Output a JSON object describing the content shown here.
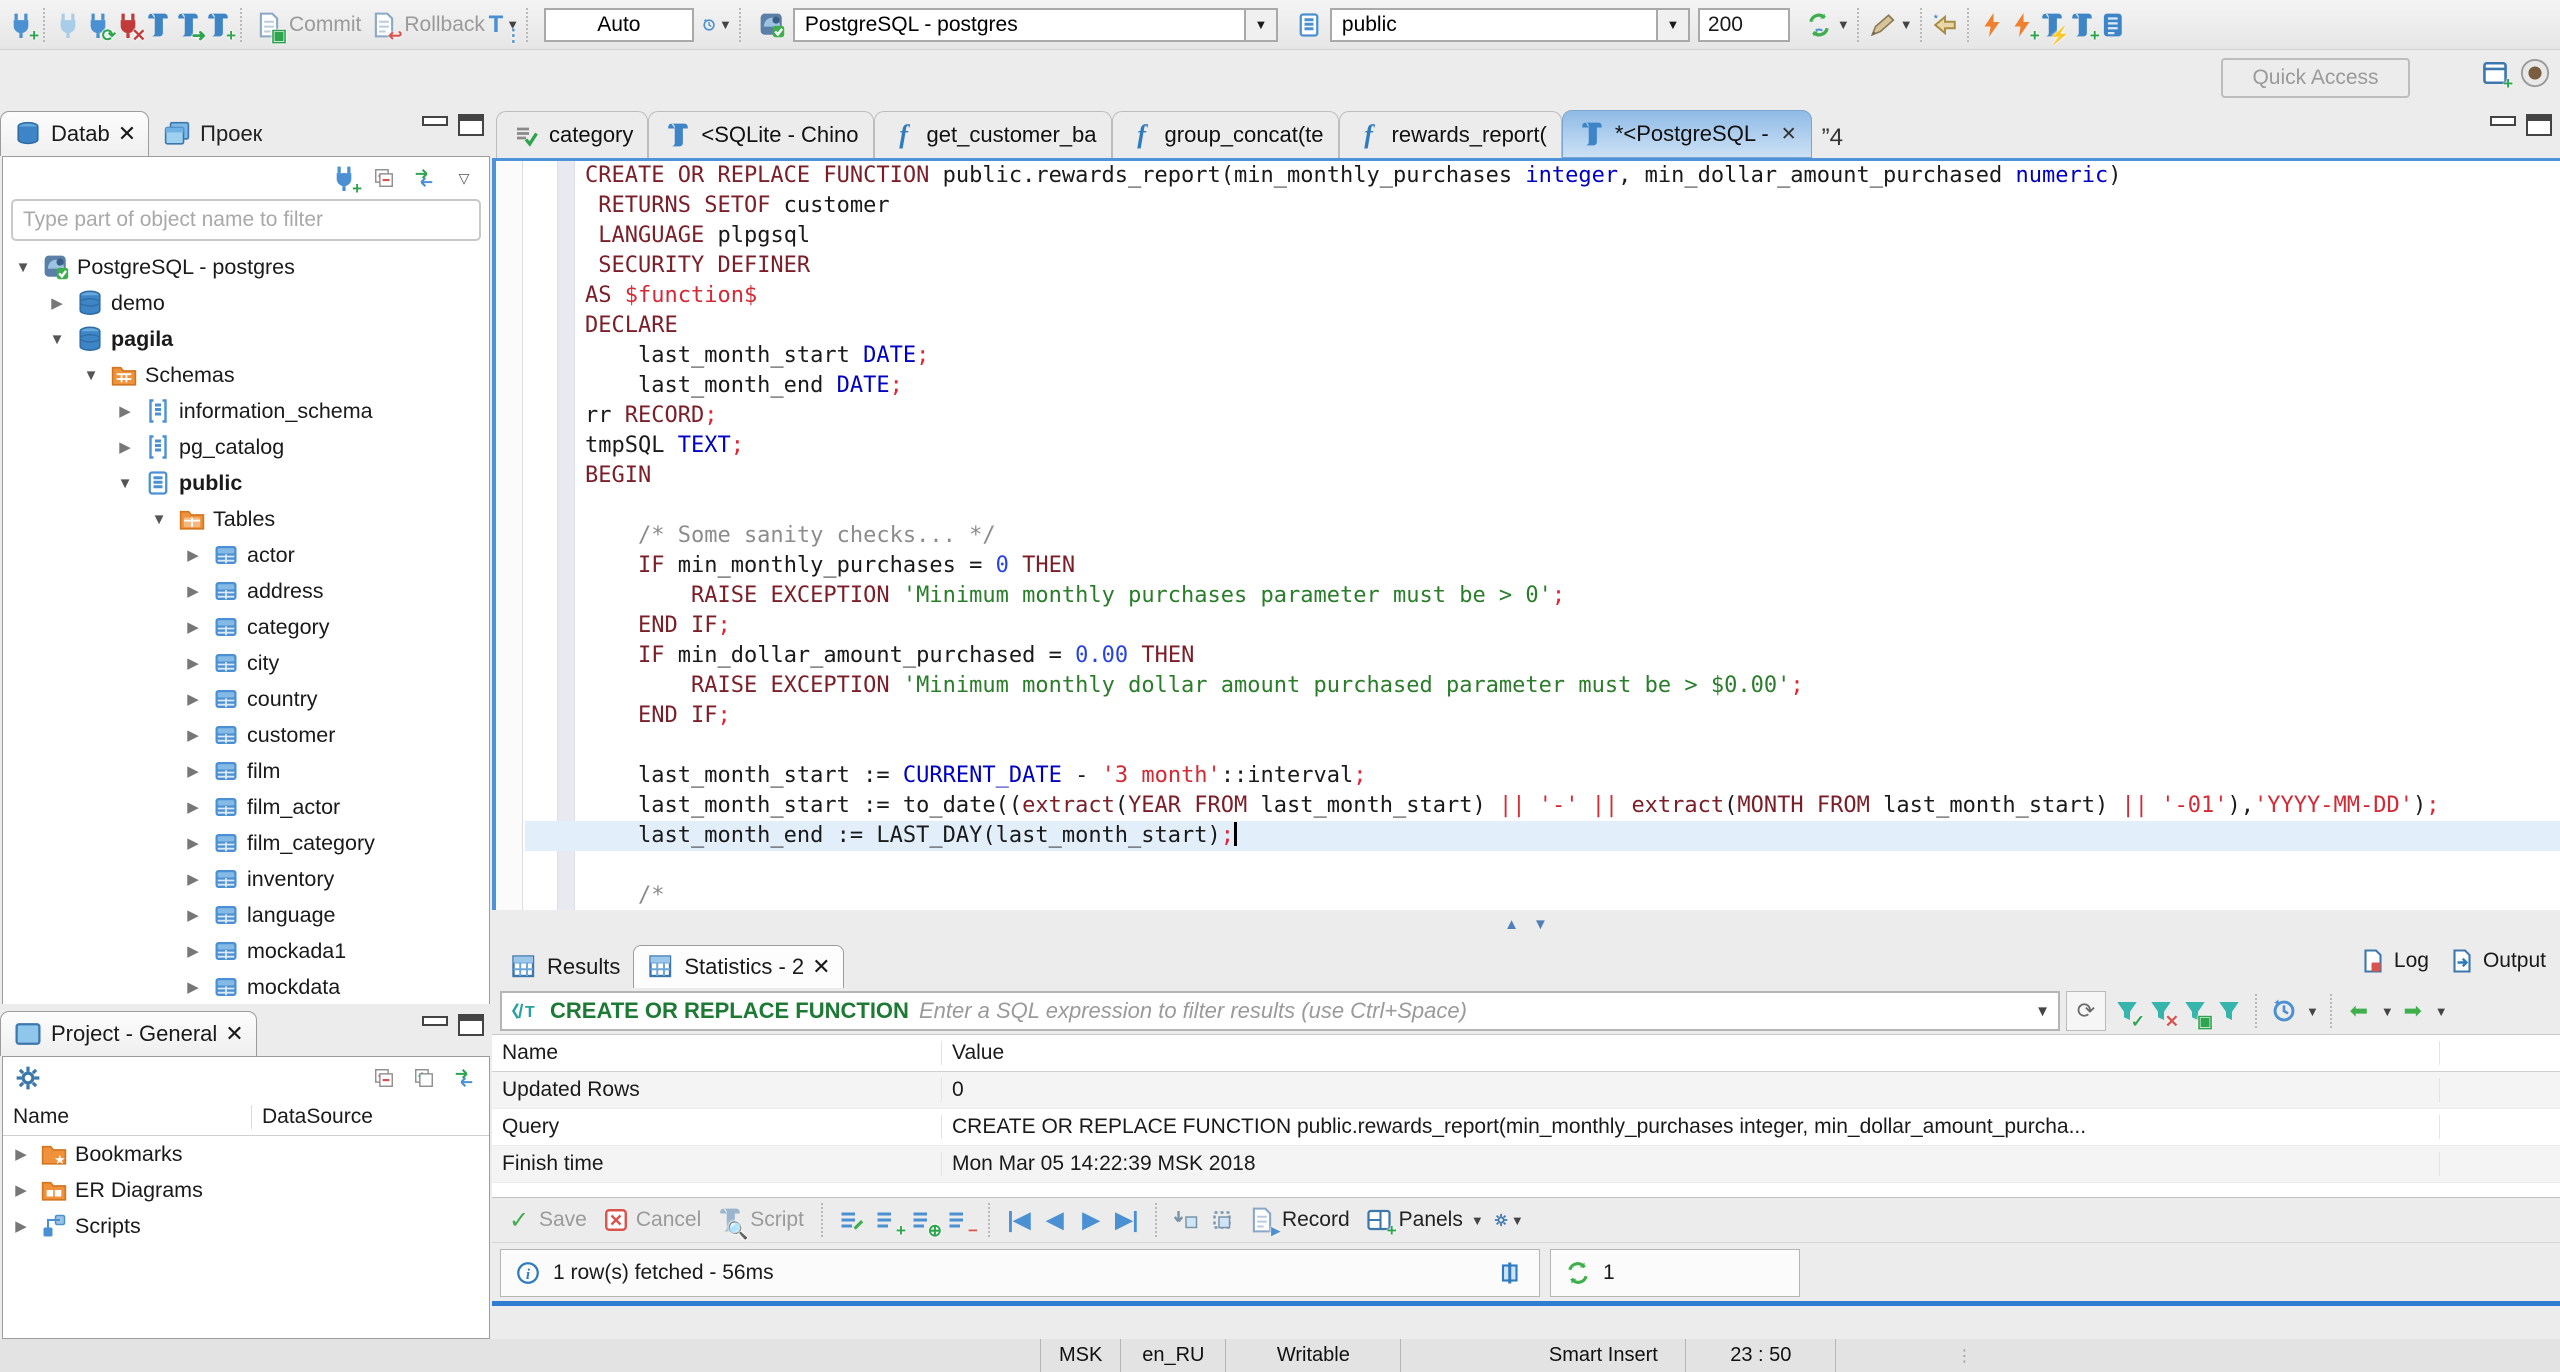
{
  "toolbar": {
    "main_icons_left": [
      "new-connection",
      "connect",
      "reconnect",
      "disconnect",
      "sql-editor",
      "open-sql-script",
      "new-sql-editor"
    ],
    "commit_label": "Commit",
    "rollback_label": "Rollback",
    "transaction_mode_icon": "transaction-mode",
    "auto_label": "Auto",
    "history_icon": "clock-history",
    "connection_combo": {
      "icon": "postgres-connection",
      "value": "PostgreSQL - postgres"
    },
    "schema_combo": {
      "icon": "schema-page",
      "value": "public"
    },
    "fetch_size": "200",
    "main_icons_right": [
      "sync-connection",
      "assistant-pen",
      "back-star",
      "execute-bolt",
      "execute-bolt-new",
      "script-bolt",
      "script-new",
      "script-list"
    ],
    "quick_access_placeholder": "Quick Access",
    "corner_icons": [
      "open-perspective",
      "dbeaver-perspective"
    ]
  },
  "navigator": {
    "tab_database": "Datab",
    "tab_project": "Проек",
    "toolbar_icons": [
      "connect-plug",
      "collapse-all",
      "link-editor",
      "view-menu"
    ],
    "filter_placeholder": "Type part of object name to filter",
    "items": [
      {
        "label": "PostgreSQL - postgres",
        "level": 0,
        "state": "open",
        "icon": "conn",
        "bold": false
      },
      {
        "label": "demo",
        "level": 1,
        "state": "closed",
        "icon": "db",
        "bold": false
      },
      {
        "label": "pagila",
        "level": 1,
        "state": "open",
        "icon": "db",
        "bold": true
      },
      {
        "label": "Schemas",
        "level": 2,
        "state": "open",
        "icon": "folder-schemas",
        "bold": false
      },
      {
        "label": "information_schema",
        "level": 3,
        "state": "closed",
        "icon": "schema",
        "bold": false
      },
      {
        "label": "pg_catalog",
        "level": 3,
        "state": "closed",
        "icon": "schema",
        "bold": false
      },
      {
        "label": "public",
        "level": 3,
        "state": "open",
        "icon": "schema-bold",
        "bold": true
      },
      {
        "label": "Tables",
        "level": 4,
        "state": "open",
        "icon": "folder-tables",
        "bold": false
      },
      {
        "label": "actor",
        "level": 5,
        "state": "closed",
        "icon": "table",
        "bold": false
      },
      {
        "label": "address",
        "level": 5,
        "state": "closed",
        "icon": "table",
        "bold": false
      },
      {
        "label": "category",
        "level": 5,
        "state": "closed",
        "icon": "table",
        "bold": false
      },
      {
        "label": "city",
        "level": 5,
        "state": "closed",
        "icon": "table",
        "bold": false
      },
      {
        "label": "country",
        "level": 5,
        "state": "closed",
        "icon": "table",
        "bold": false
      },
      {
        "label": "customer",
        "level": 5,
        "state": "closed",
        "icon": "table",
        "bold": false
      },
      {
        "label": "film",
        "level": 5,
        "state": "closed",
        "icon": "table",
        "bold": false
      },
      {
        "label": "film_actor",
        "level": 5,
        "state": "closed",
        "icon": "table",
        "bold": false
      },
      {
        "label": "film_category",
        "level": 5,
        "state": "closed",
        "icon": "table",
        "bold": false
      },
      {
        "label": "inventory",
        "level": 5,
        "state": "closed",
        "icon": "table",
        "bold": false
      },
      {
        "label": "language",
        "level": 5,
        "state": "closed",
        "icon": "table",
        "bold": false
      },
      {
        "label": "mockada1",
        "level": 5,
        "state": "closed",
        "icon": "table",
        "bold": false
      },
      {
        "label": "mockdata",
        "level": 5,
        "state": "closed",
        "icon": "table",
        "bold": false
      }
    ]
  },
  "project_panel": {
    "title": "Project - General",
    "toolbar_icons": [
      "gear",
      "collapse-all",
      "expand-all",
      "link-editor"
    ],
    "columns": [
      "Name",
      "DataSource"
    ],
    "items": [
      {
        "label": "Bookmarks",
        "icon": "bookmarks"
      },
      {
        "label": "ER Diagrams",
        "icon": "erd"
      },
      {
        "label": "Scripts",
        "icon": "scripts"
      }
    ]
  },
  "editor": {
    "tabs": [
      {
        "label": "category",
        "icon": "checklist",
        "active": false
      },
      {
        "label": "<SQLite - Chino",
        "icon": "sql",
        "active": false
      },
      {
        "label": "get_customer_ba",
        "icon": "function",
        "active": false
      },
      {
        "label": "group_concat(te",
        "icon": "function",
        "active": false
      },
      {
        "label": "rewards_report(",
        "icon": "function",
        "active": false
      },
      {
        "label": "*<PostgreSQL - ",
        "icon": "sql",
        "active": true,
        "closable": true
      }
    ],
    "overflow_count": "”4",
    "current_line": 23,
    "code_lines": [
      [
        [
          "kw",
          "CREATE OR REPLACE FUNCTION"
        ],
        [
          "id",
          " public.rewards_report(min_monthly_purchases "
        ],
        [
          "ty",
          "integer"
        ],
        [
          "id",
          ", min_dollar_amount_purchased "
        ],
        [
          "ty",
          "numeric"
        ],
        [
          "id",
          ")"
        ]
      ],
      [
        [
          "id",
          " "
        ],
        [
          "kw",
          "RETURNS SETOF"
        ],
        [
          "id",
          " customer"
        ]
      ],
      [
        [
          "id",
          " "
        ],
        [
          "kw",
          "LANGUAGE"
        ],
        [
          "id",
          " plpgsql"
        ]
      ],
      [
        [
          "id",
          " "
        ],
        [
          "kw",
          "SECURITY DEFINER"
        ]
      ],
      [
        [
          "kw",
          "AS"
        ],
        [
          "rs",
          " $function$"
        ]
      ],
      [
        [
          "kw",
          "DECLARE"
        ]
      ],
      [
        [
          "id",
          "    last_month_start "
        ],
        [
          "ty",
          "DATE"
        ],
        [
          "pn",
          ";"
        ]
      ],
      [
        [
          "id",
          "    last_month_end "
        ],
        [
          "ty",
          "DATE"
        ],
        [
          "pn",
          ";"
        ]
      ],
      [
        [
          "id",
          "rr "
        ],
        [
          "kw",
          "RECORD"
        ],
        [
          "pn",
          ";"
        ]
      ],
      [
        [
          "id",
          "tmpSQL "
        ],
        [
          "ty",
          "TEXT"
        ],
        [
          "pn",
          ";"
        ]
      ],
      [
        [
          "kw",
          "BEGIN"
        ]
      ],
      [],
      [
        [
          "cm",
          "    /* Some sanity checks... */"
        ]
      ],
      [
        [
          "id",
          "    "
        ],
        [
          "kw",
          "IF"
        ],
        [
          "id",
          " min_monthly_purchases = "
        ],
        [
          "num",
          "0"
        ],
        [
          "id",
          " "
        ],
        [
          "kw",
          "THEN"
        ]
      ],
      [
        [
          "id",
          "        "
        ],
        [
          "kw",
          "RAISE EXCEPTION"
        ],
        [
          "str",
          " 'Minimum monthly purchases parameter must be > 0'"
        ],
        [
          "pn",
          ";"
        ]
      ],
      [
        [
          "id",
          "    "
        ],
        [
          "kw",
          "END IF"
        ],
        [
          "pn",
          ";"
        ]
      ],
      [
        [
          "id",
          "    "
        ],
        [
          "kw",
          "IF"
        ],
        [
          "id",
          " min_dollar_amount_purchased = "
        ],
        [
          "num",
          "0.00"
        ],
        [
          "id",
          " "
        ],
        [
          "kw",
          "THEN"
        ]
      ],
      [
        [
          "id",
          "        "
        ],
        [
          "kw",
          "RAISE EXCEPTION"
        ],
        [
          "str",
          " 'Minimum monthly dollar amount purchased parameter must be > $0.00'"
        ],
        [
          "pn",
          ";"
        ]
      ],
      [
        [
          "id",
          "    "
        ],
        [
          "kw",
          "END IF"
        ],
        [
          "pn",
          ";"
        ]
      ],
      [],
      [
        [
          "id",
          "    last_month_start := "
        ],
        [
          "ty",
          "CURRENT_DATE"
        ],
        [
          "id",
          " - "
        ],
        [
          "rs",
          "'3 month'"
        ],
        [
          "id",
          "::interval"
        ],
        [
          "pn",
          ";"
        ]
      ],
      [
        [
          "id",
          "    last_month_start := to_date(("
        ],
        [
          "kw",
          "extract"
        ],
        [
          "id",
          "("
        ],
        [
          "kw",
          "YEAR"
        ],
        [
          "id",
          " "
        ],
        [
          "kw",
          "FROM"
        ],
        [
          "id",
          " last_month_start) "
        ],
        [
          "op",
          "||"
        ],
        [
          "rs",
          " '-' "
        ],
        [
          "op",
          "||"
        ],
        [
          "id",
          " "
        ],
        [
          "kw",
          "extract"
        ],
        [
          "id",
          "("
        ],
        [
          "kw",
          "MONTH"
        ],
        [
          "id",
          " "
        ],
        [
          "kw",
          "FROM"
        ],
        [
          "id",
          " last_month_start) "
        ],
        [
          "op",
          "||"
        ],
        [
          "rs",
          " '-01'"
        ],
        [
          "id",
          "),"
        ],
        [
          "rs",
          "'YYYY-MM-DD'"
        ],
        [
          "id",
          ")"
        ],
        [
          "pn",
          ";"
        ]
      ],
      [
        [
          "id",
          "    last_month_end := LAST_DAY(last_month_start)"
        ],
        [
          "pn",
          ";"
        ]
      ],
      [],
      [
        [
          "cm",
          "    /*"
        ]
      ]
    ]
  },
  "results": {
    "tab_results": "Results",
    "tab_statistics": "Statistics - 2",
    "log_label": "Log",
    "output_label": "Output",
    "filter_prefix": "CREATE OR REPLACE FUNCTION",
    "filter_placeholder": "Enter a SQL expression to filter results (use Ctrl+Space)",
    "filter_icons": [
      "filter-apply",
      "filter-remove",
      "filter-save",
      "filter-custom",
      "auto-refresh",
      "nav-back",
      "nav-forward"
    ],
    "columns": [
      "Name",
      "Value"
    ],
    "rows": [
      {
        "name": "Updated Rows",
        "value": "0"
      },
      {
        "name": "Query",
        "value": "CREATE OR REPLACE FUNCTION public.rewards_report(min_monthly_purchases integer, min_dollar_amount_purcha..."
      },
      {
        "name": "Finish time",
        "value": "Mon Mar 05 14:22:39 MSK 2018"
      }
    ],
    "toolbar": {
      "save_label": "Save",
      "cancel_label": "Cancel",
      "script_label": "Script",
      "record_label": "Record",
      "panels_label": "Panels"
    },
    "status_text": "1 row(s) fetched - 56ms",
    "exec_count": "1"
  },
  "statusbar": {
    "items": [
      "MSK",
      "en_RU",
      "Writable",
      "Smart Insert",
      "23 : 50"
    ]
  }
}
